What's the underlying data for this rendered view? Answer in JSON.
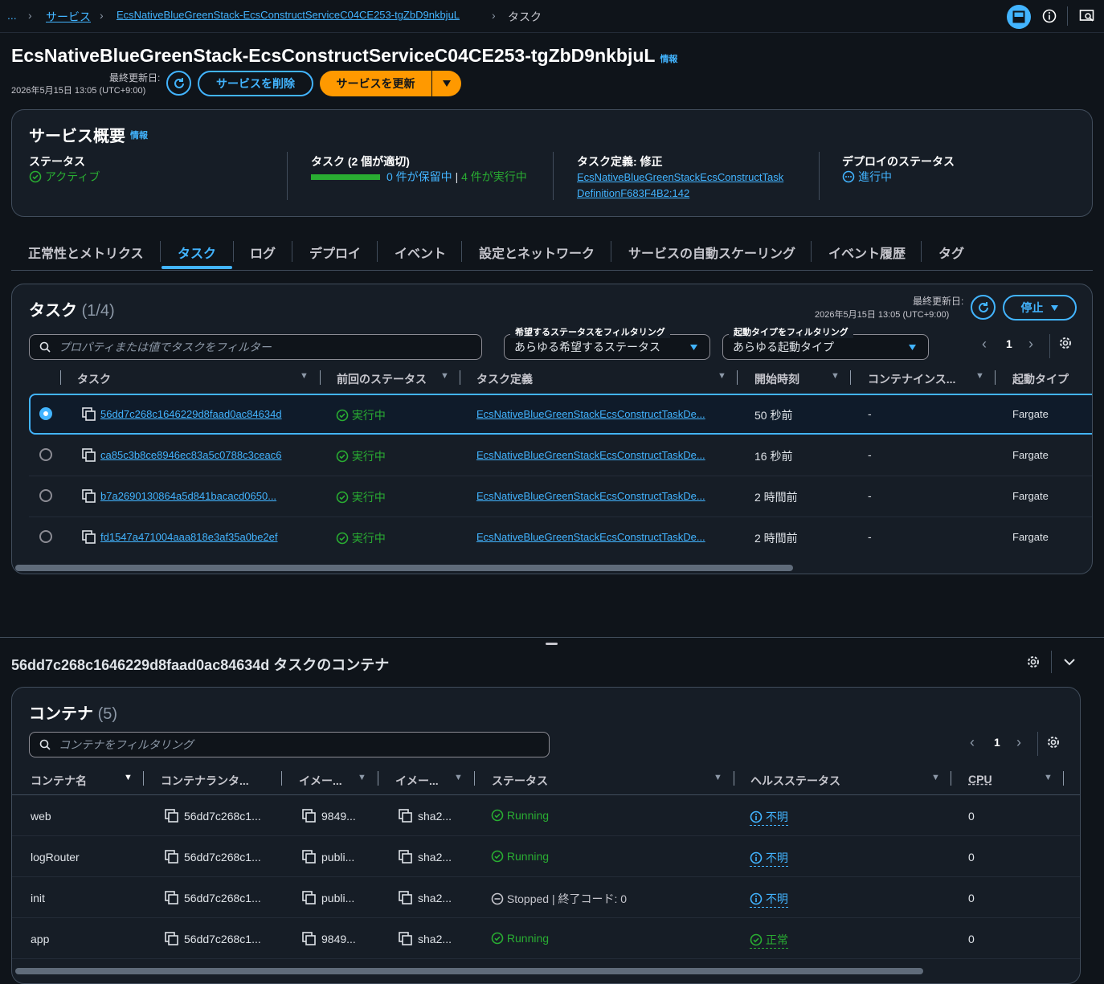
{
  "breadcrumb": {
    "ellipsis": "...",
    "services": "サービス",
    "service": "EcsNativeBlueGreenStack-EcsConstructServiceC04CE253-tgZbD9nkbjuL",
    "current": "タスク"
  },
  "header": {
    "title": "EcsNativeBlueGreenStack-EcsConstructServiceC04CE253-tgZbD9nkbjuL",
    "info": "情報",
    "last_updated_label": "最終更新日:",
    "last_updated": "2026年5月15日 13:05 (UTC+9:00)",
    "delete_button": "サービスを削除",
    "update_button": "サービスを更新"
  },
  "overview": {
    "title": "サービス概要",
    "info": "情報",
    "status_label": "ステータス",
    "status_value": "アクティブ",
    "tasks_label": "タスク (2 個が適切)",
    "tasks_pending": "0 件が保留中",
    "tasks_sep": "|",
    "tasks_running": "4 件が実行中",
    "taskdef_label": "タスク定義: 修正",
    "taskdef_line1": "EcsNativeBlueGreenStackEcsConstructTask",
    "taskdef_line2": "DefinitionF683F4B2:142",
    "deploy_label": "デプロイのステータス",
    "deploy_value": "進行中"
  },
  "tabs": [
    "正常性とメトリクス",
    "タスク",
    "ログ",
    "デプロイ",
    "イベント",
    "設定とネットワーク",
    "サービスの自動スケーリング",
    "イベント履歴",
    "タグ"
  ],
  "tasks": {
    "title": "タスク",
    "count": "(1/4)",
    "last_updated_label": "最終更新日:",
    "last_updated": "2026年5月15日 13:05 (UTC+9:00)",
    "stop_button": "停止",
    "filter_placeholder": "プロパティまたは値でタスクをフィルター",
    "desired_label": "希望するステータスをフィルタリング",
    "desired_value": "あらゆる希望するステータス",
    "launch_label": "起動タイプをフィルタリング",
    "launch_value": "あらゆる起動タイプ",
    "page": "1",
    "columns": [
      "タスク",
      "前回のステータス",
      "タスク定義",
      "開始時刻",
      "コンテナインス...",
      "起動タイプ"
    ],
    "rows": [
      {
        "id": "56dd7c268c1646229d8faad0ac84634d",
        "status": "実行中",
        "taskdef": "EcsNativeBlueGreenStackEcsConstructTaskDe...",
        "started": "50 秒前",
        "instance": "-",
        "launch": "Fargate"
      },
      {
        "id": "ca85c3b8ce8946ec83a5c0788c3ceac6",
        "status": "実行中",
        "taskdef": "EcsNativeBlueGreenStackEcsConstructTaskDe...",
        "started": "16 秒前",
        "instance": "-",
        "launch": "Fargate"
      },
      {
        "id": "b7a2690130864a5d841bacacd0650...",
        "status": "実行中",
        "taskdef": "EcsNativeBlueGreenStackEcsConstructTaskDe...",
        "started": "2 時間前",
        "instance": "-",
        "launch": "Fargate"
      },
      {
        "id": "fd1547a471004aaa818e3af35a0be2ef",
        "status": "実行中",
        "taskdef": "EcsNativeBlueGreenStackEcsConstructTaskDe...",
        "started": "2 時間前",
        "instance": "-",
        "launch": "Fargate"
      }
    ]
  },
  "split": {
    "title": "56dd7c268c1646229d8faad0ac84634d タスクのコンテナ"
  },
  "containers": {
    "title": "コンテナ",
    "count": "(5)",
    "filter_placeholder": "コンテナをフィルタリング",
    "page": "1",
    "columns": [
      "コンテナ名",
      "コンテナランタ...",
      "イメー...",
      "イメー...",
      "ステータス",
      "ヘルスステータス",
      "CPU"
    ],
    "rows": [
      {
        "name": "web",
        "runtime": "56dd7c268c1...",
        "image": "9849...",
        "digest": "sha2...",
        "status": "Running",
        "health": "不明",
        "cpu": "0"
      },
      {
        "name": "logRouter",
        "runtime": "56dd7c268c1...",
        "image": "publi...",
        "digest": "sha2...",
        "status": "Running",
        "health": "不明",
        "cpu": "0"
      },
      {
        "name": "init",
        "runtime": "56dd7c268c1...",
        "image": "publi...",
        "digest": "sha2...",
        "status": "Stopped | 終了コード: 0",
        "health": "不明",
        "cpu": "0"
      },
      {
        "name": "app",
        "runtime": "56dd7c268c1...",
        "image": "9849...",
        "digest": "sha2...",
        "status": "Running",
        "health": "正常",
        "cpu": "0"
      }
    ]
  }
}
